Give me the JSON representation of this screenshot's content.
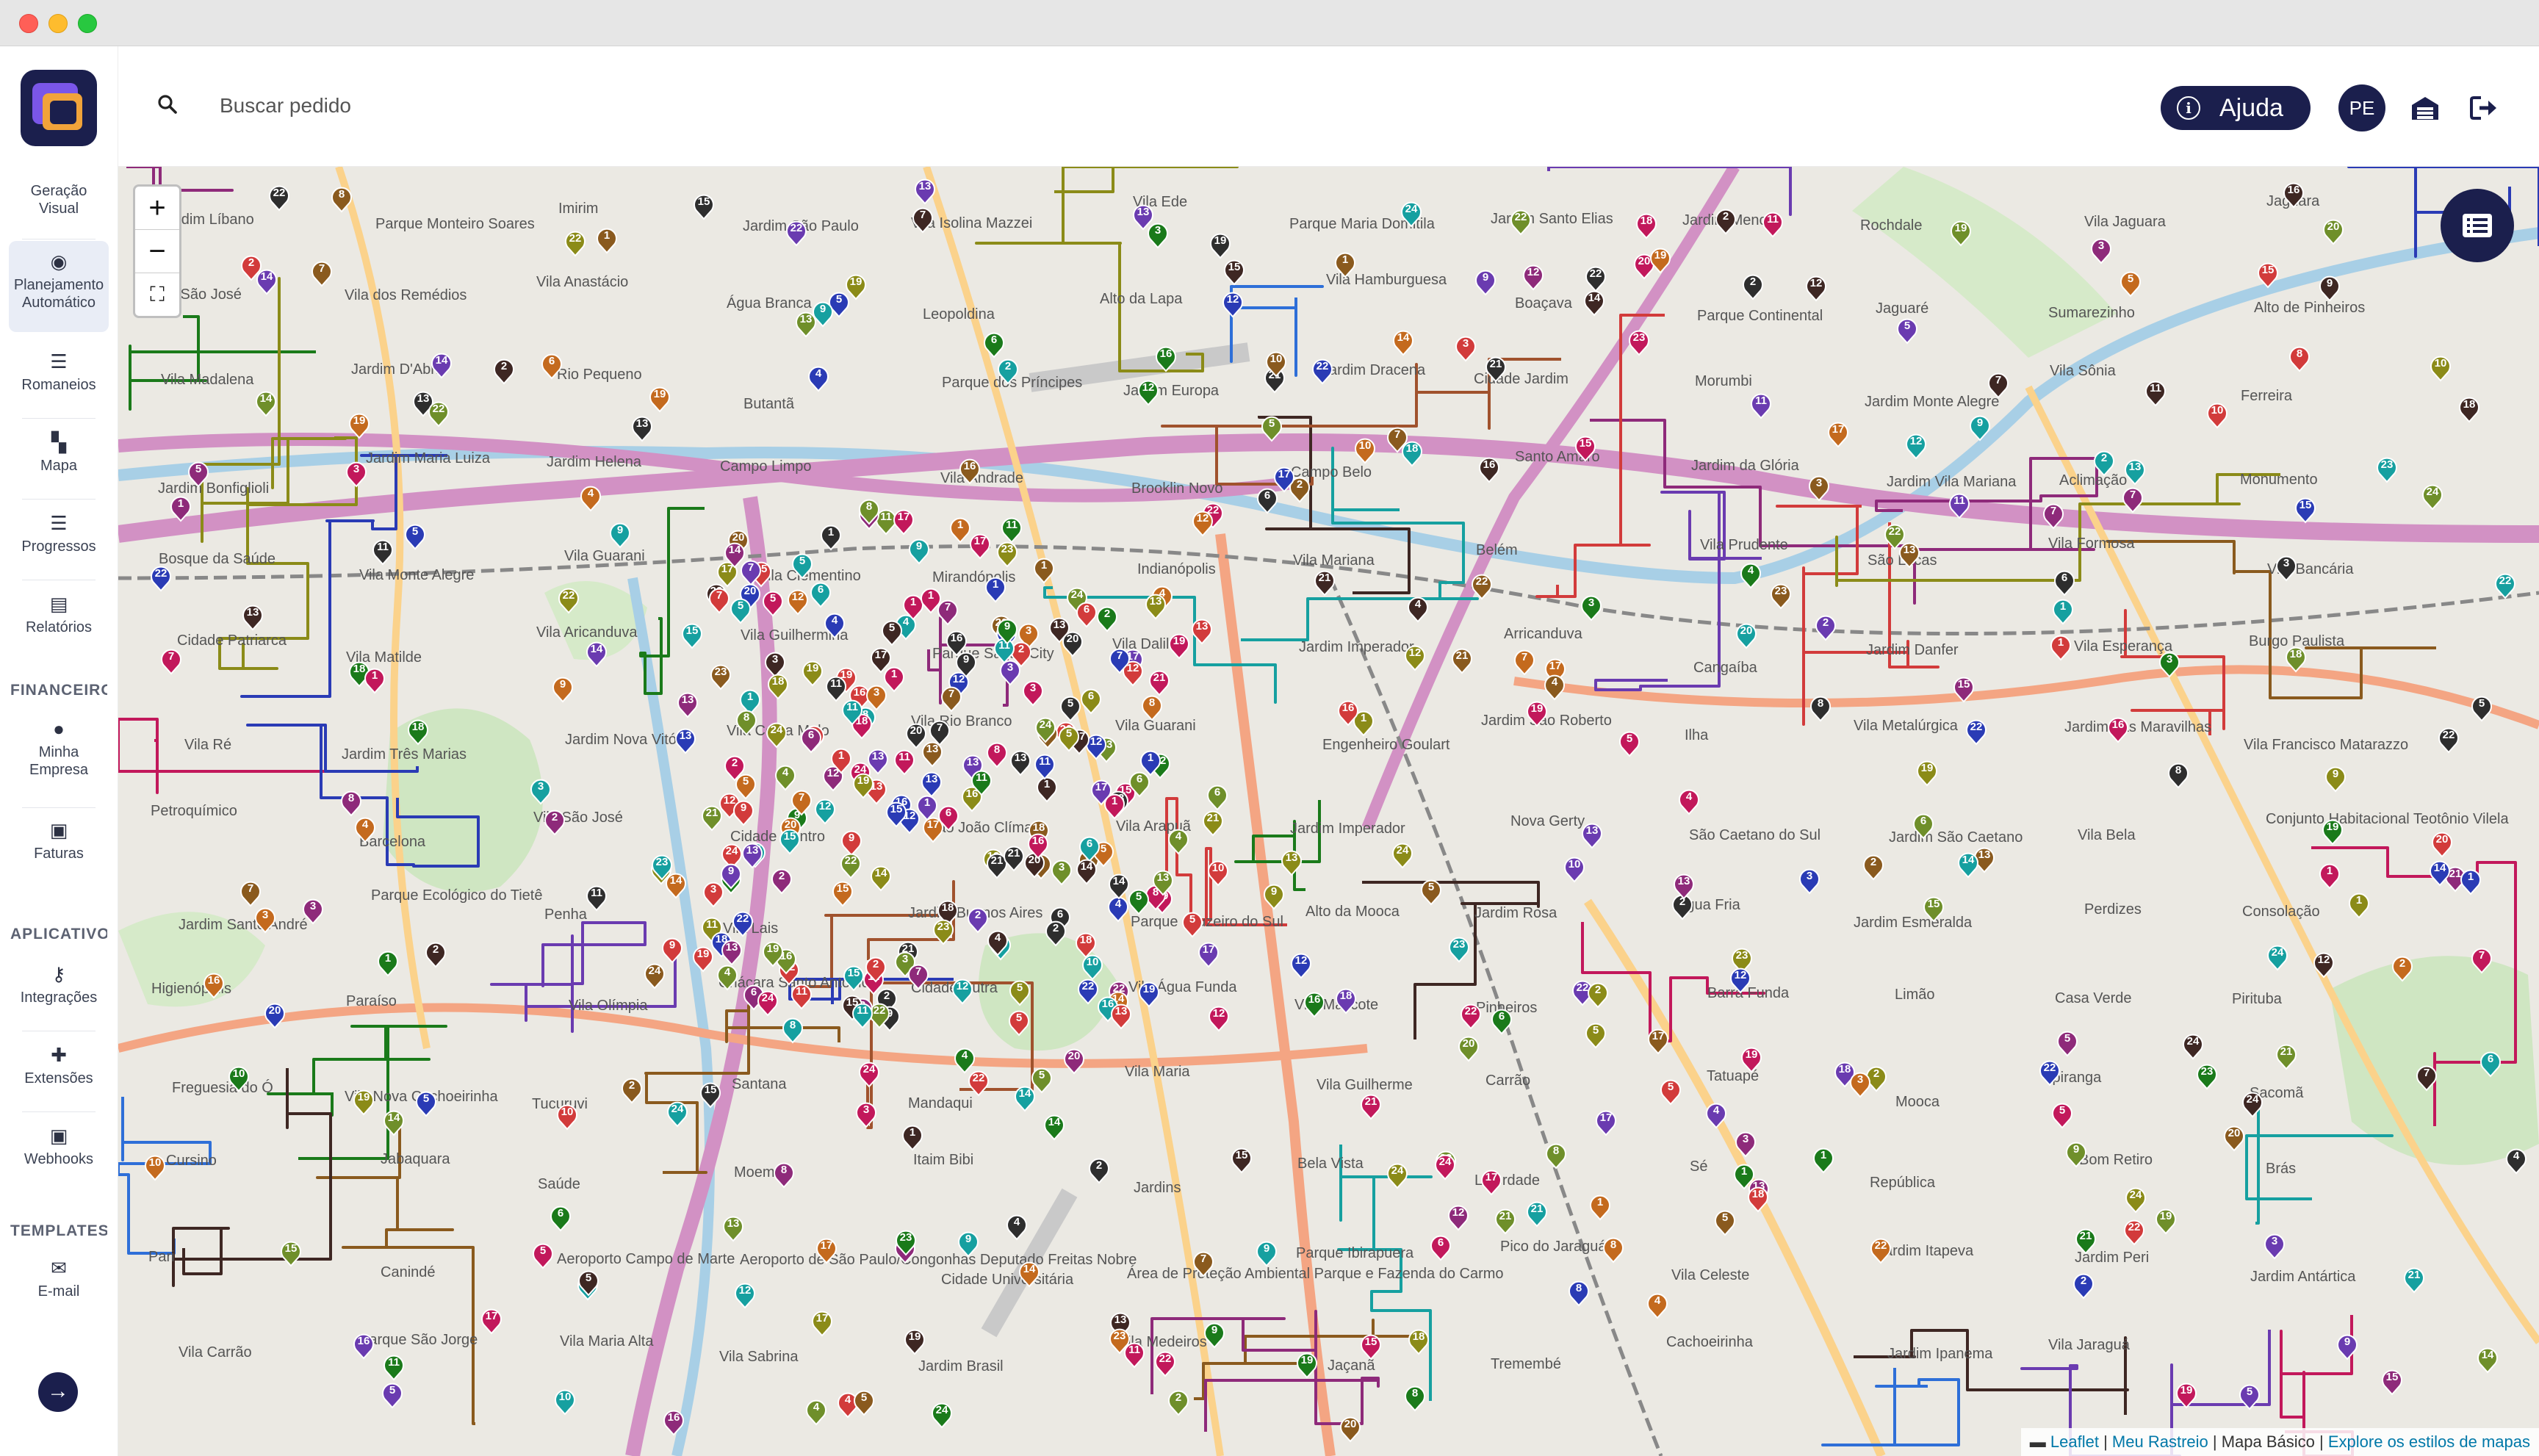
{
  "sidebar": {
    "items": [
      {
        "label": "Geração Visual"
      },
      {
        "label": "Planejamento Automático"
      },
      {
        "label": "Romaneios"
      },
      {
        "label": "Mapa"
      },
      {
        "label": "Progressos"
      },
      {
        "label": "Relatórios"
      },
      {
        "label": "Minha Empresa"
      },
      {
        "label": "Faturas"
      },
      {
        "label": "Integrações"
      },
      {
        "label": "Extensões"
      },
      {
        "label": "Webhooks"
      },
      {
        "label": "E-mail"
      }
    ],
    "sections": {
      "financeiro": "FINANCEIRO",
      "aplicativo": "APLICATIVO",
      "templates": "TEMPLATES"
    }
  },
  "header": {
    "search_placeholder": "Buscar pedido",
    "help_label": "Ajuda",
    "avatar_initials": "PE"
  },
  "map": {
    "attribution": {
      "leaflet": "Leaflet",
      "meu_rastreio": "Meu Rastreio",
      "mapa_basico": "Mapa Básico",
      "explore": "Explore os estilos de mapas"
    },
    "place_labels": [
      "Jardim Líbano",
      "Parque Monteiro Soares",
      "Imirim",
      "Jardim São Paulo",
      "Vila Isolina Mazzei",
      "Vila Ede",
      "Parque Maria Domitila",
      "Jardim Santo Elias",
      "Jardim Menck",
      "Rochdale",
      "Vila Jaguara",
      "Jaguara",
      "Vila São José",
      "Vila dos Remédios",
      "Vila Anastácio",
      "Água Branca",
      "Leopoldina",
      "Alto da Lapa",
      "Vila Hamburguesa",
      "Boaçava",
      "Parque Continental",
      "Jaguaré",
      "Sumarezinho",
      "Alto de Pinheiros",
      "Vila Madalena",
      "Jardim D'Abril",
      "Rio Pequeno",
      "Butantã",
      "Parque dos Príncipes",
      "Jardim Europa",
      "Jardim Dracena",
      "Cidade Jardim",
      "Morumbi",
      "Jardim Monte Alegre",
      "Vila Sônia",
      "Ferreira",
      "Jardim Bonfiglioli",
      "Jardim Maria Luiza",
      "Jardim Helena",
      "Campo Limpo",
      "Vila Andrade",
      "Brooklin Novo",
      "Campo Belo",
      "Santo Amaro",
      "Jardim da Glória",
      "Jardim Vila Mariana",
      "Aclimação",
      "Monumento",
      "Bosque da Saúde",
      "Vila Monte Alegre",
      "Vila Guarani",
      "Vila Clementino",
      "Mirandópolis",
      "Indianópolis",
      "Vila Mariana",
      "Belém",
      "Vila Prudente",
      "São Lucas",
      "Vila Formosa",
      "Vila Bancária",
      "Cidade Patriarca",
      "Vila Matilde",
      "Vila Aricanduva",
      "Vila Guilhermina",
      "Parque Savoy City",
      "Vila Dalila",
      "Jardim Imperador",
      "Arricanduva",
      "Cangaíba",
      "Jardim Danfer",
      "Vila Esperança",
      "Burgo Paulista",
      "Vila Ré",
      "Jardim Três Marias",
      "Jardim Nova Vitória",
      "Vila Costa Melo",
      "Vila Rio Branco",
      "Vila Guarani",
      "Engenheiro Goulart",
      "Jardim São Roberto",
      "Ilha",
      "Vila Metalúrgica",
      "Jardim das Maravilhas",
      "Vila Francisco Matarazzo",
      "Petroquímico",
      "Barcelona",
      "Vila São José",
      "Cidade Centro",
      "São João Clímaco",
      "Vila Arapuã",
      "Jardim Imperador",
      "Nova Gerty",
      "São Caetano do Sul",
      "Jardim São Caetano",
      "Vila Bela",
      "Conjunto Habitacional Teotônio Vilela",
      "Jardim Santo André",
      "Parque Ecológico do Tietê",
      "Penha",
      "Vila Lais",
      "Jardim Buenos Aires",
      "Parque Cruzeiro do Sul",
      "Alto da Mooca",
      "Jardim Rosa",
      "Água Fria",
      "Jardim Esmeralda",
      "Perdizes",
      "Consolação",
      "Higienópolis",
      "Paraíso",
      "Vila Olímpia",
      "Chácara Santo Antônio",
      "Cidade Dutra",
      "Vila Água Funda",
      "Vila Mascote",
      "Pinheiros",
      "Barra Funda",
      "Limão",
      "Casa Verde",
      "Pirituba",
      "Freguesia do Ó",
      "Vila Nova Cachoeirinha",
      "Tucuruvi",
      "Santana",
      "Mandaqui",
      "Vila Maria",
      "Vila Guilherme",
      "Carrão",
      "Tatuapé",
      "Mooca",
      "Ipiranga",
      "Sacomã",
      "Cursino",
      "Jabaquara",
      "Saúde",
      "Moema",
      "Itaim Bibi",
      "Jardins",
      "Bela Vista",
      "Liberdade",
      "Sé",
      "República",
      "Bom Retiro",
      "Brás",
      "Pari",
      "Canindé",
      "Aeroporto Campo de Marte",
      "Aeroporto de São Paulo/Congonhas Deputado Freitas Nobre",
      "Cidade Universitária",
      "Área de Proteção Ambiental Parque e Fazenda do Carmo",
      "Parque Ibirapuera",
      "Pico do Jaraguá",
      "Vila Celeste",
      "Jardim Itapeva",
      "Jardim Peri",
      "Jardim Antártica",
      "Vila Carrão",
      "Parque São Jorge",
      "Vila Maria Alta",
      "Vila Sabrina",
      "Jardim Brasil",
      "Vila Medeiros",
      "Jaçanã",
      "Tremembé",
      "Cachoeirinha",
      "Jardim Ipanema",
      "Vila Jaraguá"
    ],
    "marker_colors": [
      "#1a7a1a",
      "#c2185b",
      "#2a3bb5",
      "#8e2a7a",
      "#8a5a1e",
      "#3e2723",
      "#d23b3b",
      "#16a0a0",
      "#8b8b18",
      "#6a3bb0",
      "#2e2e2e",
      "#c46a1e",
      "#6f8f2a"
    ],
    "route_colors": [
      "#1a7a1a",
      "#8a5a1e",
      "#2a3bb5",
      "#8e2a7a",
      "#16a0a0",
      "#c2185b",
      "#8b8b18",
      "#3e2723",
      "#6a3bb0",
      "#d23b3b",
      "#2e6fd8",
      "#a0522d"
    ]
  }
}
